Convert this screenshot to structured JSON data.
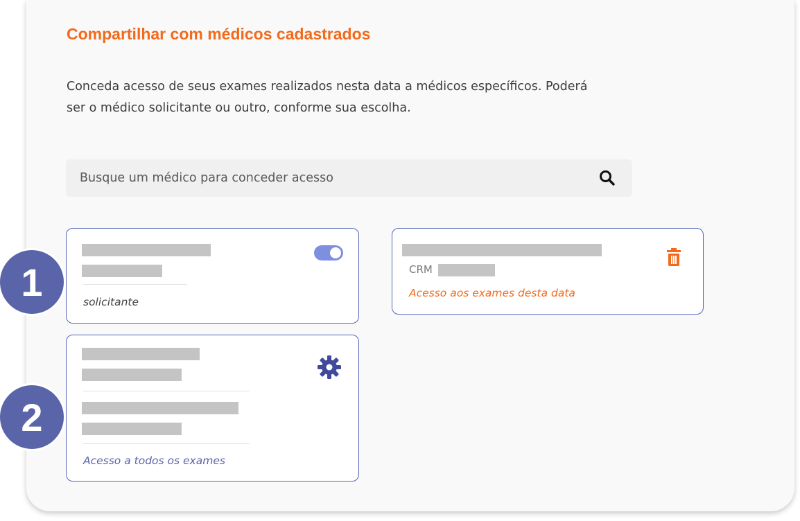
{
  "section": {
    "title": "Compartilhar com médicos cadastrados",
    "description": "Conceda acesso de seus exames realizados nesta data a médicos específicos. Poderá ser o médico solicitante ou outro, conforme sua escolha."
  },
  "search": {
    "placeholder": "Busque um médico para conceder acesso",
    "icon": "search-icon"
  },
  "badges": [
    "1",
    "2"
  ],
  "cards": {
    "requesting_doctor": {
      "role_label": "solicitante",
      "toggle_on": true,
      "icon": "toggle-switch"
    },
    "date_access_doctor": {
      "crm_label": "CRM",
      "access_label": "Acesso aos exames desta data",
      "icon": "trash-icon"
    },
    "all_exams_doctor": {
      "access_label": "Acesso a todos os exames",
      "icon": "gear-icon"
    }
  },
  "colors": {
    "accent_orange": "#f26a1b",
    "accent_blue": "#5566b8",
    "toggle_blue": "#7e8fe0",
    "badge_blue": "#5a64a8",
    "placeholder_gray": "#c4c4c4"
  }
}
